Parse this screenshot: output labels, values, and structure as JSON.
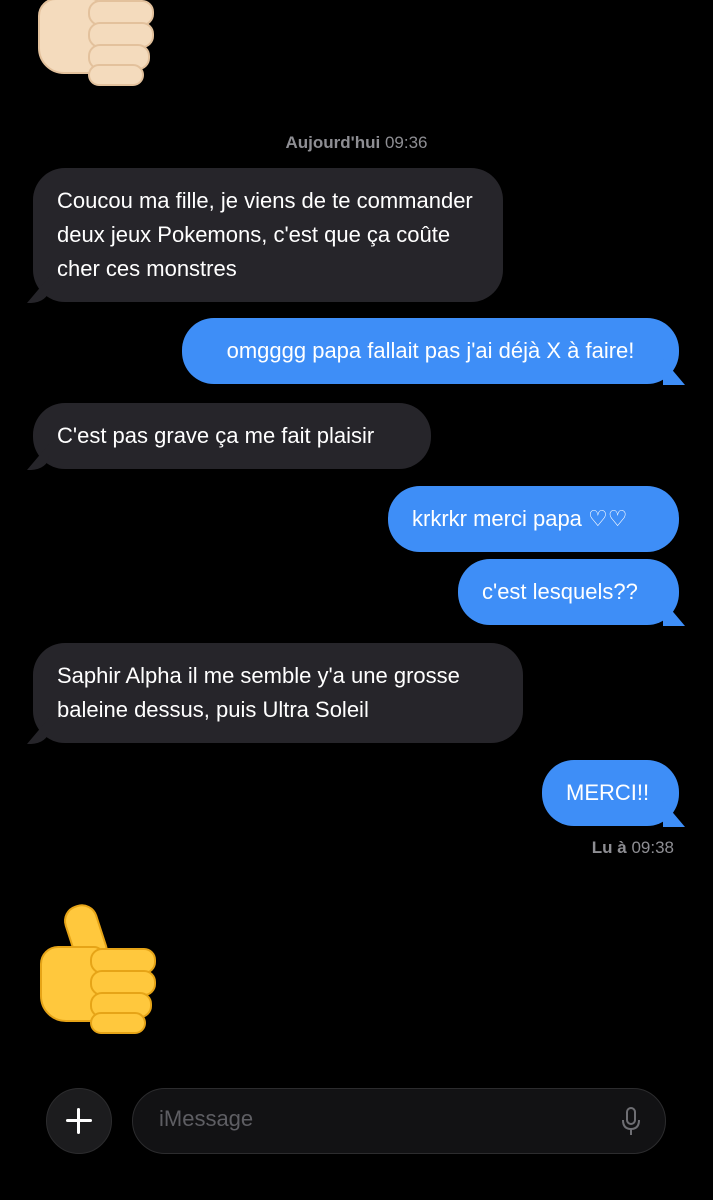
{
  "conversation": {
    "timestamp_day": "Aujourd'hui",
    "timestamp_time": "09:36",
    "messages": [
      {
        "sender": "received",
        "text": "Coucou ma fille, je viens de te commander deux jeux Pokemons, c'est que ça coûte cher ces monstres"
      },
      {
        "sender": "sent",
        "text": "omgggg papa fallait pas j'ai déjà X à faire!"
      },
      {
        "sender": "received",
        "text": "C'est pas grave ça me fait plaisir"
      },
      {
        "sender": "sent",
        "text": "krkrkr merci papa ♡♡"
      },
      {
        "sender": "sent",
        "text": "c'est lesquels??"
      },
      {
        "sender": "received",
        "text": "Saphir Alpha il me semble y'a une grosse baleine dessus, puis Ultra Soleil"
      },
      {
        "sender": "sent",
        "text": "MERCI!!"
      }
    ],
    "read_receipt_label": "Lu à",
    "read_receipt_time": "09:38"
  },
  "composer": {
    "placeholder": "iMessage",
    "plus_icon": "plus-icon",
    "mic_icon": "microphone-icon"
  },
  "emojis": {
    "top": "thumbs-up-light-skin-icon",
    "bottom": "thumbs-up-icon"
  },
  "colors": {
    "sent_bubble": "#3e8ef7",
    "received_bubble": "#26252a",
    "background": "#000000",
    "secondary_text": "#8e8e93"
  }
}
